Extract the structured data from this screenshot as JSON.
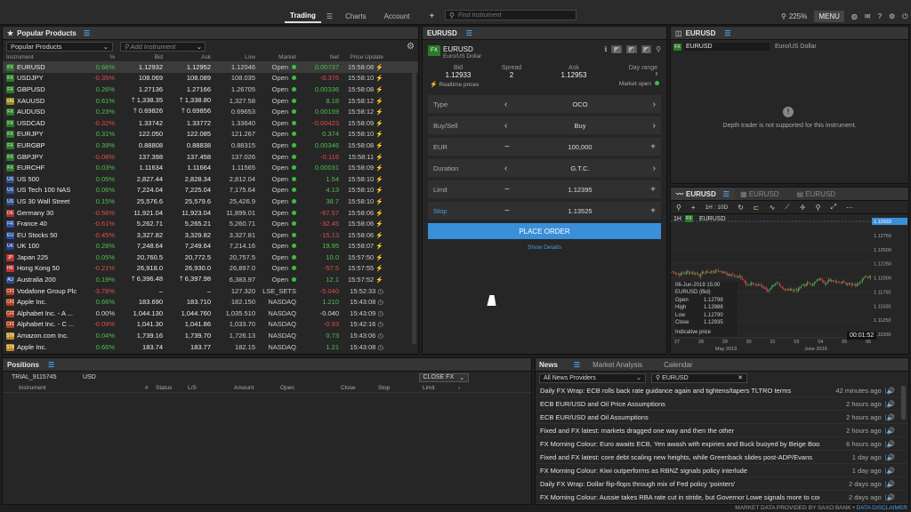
{
  "topbar": {
    "tabs": [
      "Trading",
      "Charts",
      "Account"
    ],
    "add": "+",
    "search_placeholder": "Find Instrument",
    "zoom": "225%",
    "menu": "MENU"
  },
  "watchlist": {
    "title": "Popular Products",
    "list_name": "Popular Products",
    "add_placeholder": "Add Instrument",
    "columns": [
      "Instrument",
      "%",
      "Bid",
      "Ask",
      "Low",
      "Market",
      "Net",
      "Price Update"
    ],
    "rows": [
      {
        "name": "EURUSD",
        "icon": "FX",
        "pct": "0.66%",
        "bid": "1.12932",
        "ask": "1.12952",
        "low": "1.12046",
        "market": "Open",
        "net": "0.00737",
        "time": "15:58:08",
        "dir": "pos",
        "sel": true
      },
      {
        "name": "USDJPY",
        "icon": "FX",
        "pct": "-0.35%",
        "bid": "108.069",
        "ask": "108.089",
        "low": "108.035",
        "market": "Open",
        "net": "-0.376",
        "time": "15:58:10",
        "dir": "neg"
      },
      {
        "name": "GBPUSD",
        "icon": "FX",
        "pct": "0.26%",
        "bid": "1.27136",
        "ask": "1.27166",
        "low": "1.26705",
        "market": "Open",
        "net": "0.00336",
        "time": "15:58:08",
        "dir": "pos"
      },
      {
        "name": "XAUUSD",
        "icon": "XAU",
        "pct": "0.61%",
        "bid": "1,338.35",
        "ask": "1,338.80",
        "low": "1,327.58",
        "market": "Open",
        "net": "8.18",
        "time": "15:58:12",
        "dir": "pos",
        "arrow": true
      },
      {
        "name": "AUDUSD",
        "icon": "FX",
        "pct": "0.23%",
        "bid": "0.69826",
        "ask": "0.69856",
        "low": "0.69653",
        "market": "Open",
        "net": "0.00159",
        "time": "15:58:12",
        "dir": "pos",
        "arrow": true
      },
      {
        "name": "USDCAD",
        "icon": "FX",
        "pct": "-0.32%",
        "bid": "1.33742",
        "ask": "1.33772",
        "low": "1.33640",
        "market": "Open",
        "net": "-0.00423",
        "time": "15:58:09",
        "dir": "neg"
      },
      {
        "name": "EURJPY",
        "icon": "FX",
        "pct": "0.31%",
        "bid": "122.050",
        "ask": "122.085",
        "low": "121.267",
        "market": "Open",
        "net": "0.374",
        "time": "15:58:10",
        "dir": "pos"
      },
      {
        "name": "EURGBP",
        "icon": "FX",
        "pct": "0.39%",
        "bid": "0.88808",
        "ask": "0.88838",
        "low": "0.88315",
        "market": "Open",
        "net": "0.00346",
        "time": "15:58:08",
        "dir": "pos"
      },
      {
        "name": "GBPJPY",
        "icon": "FX",
        "pct": "-0.08%",
        "bid": "137.398",
        "ask": "137.458",
        "low": "137.026",
        "market": "Open",
        "net": "-0.116",
        "time": "15:58:11",
        "dir": "neg"
      },
      {
        "name": "EURCHF",
        "icon": "FX",
        "pct": "0.03%",
        "bid": "1.11634",
        "ask": "1.11664",
        "low": "1.11565",
        "market": "Open",
        "net": "0.00031",
        "time": "15:58:09",
        "dir": "pos"
      },
      {
        "name": "US 500",
        "icon": "US",
        "pct": "0.05%",
        "bid": "2,827.44",
        "ask": "2,828.34",
        "low": "2,812.04",
        "market": "Open",
        "net": "1.54",
        "time": "15:58:10",
        "dir": "pos"
      },
      {
        "name": "US Tech 100 NAS",
        "icon": "US",
        "pct": "0.06%",
        "bid": "7,224.04",
        "ask": "7,225.04",
        "low": "7,175.64",
        "market": "Open",
        "net": "4.13",
        "time": "15:58:10",
        "dir": "pos"
      },
      {
        "name": "US 30 Wall Street",
        "icon": "US",
        "pct": "0.15%",
        "bid": "25,576.6",
        "ask": "25,579.6",
        "low": "25,426.9",
        "market": "Open",
        "net": "38.7",
        "time": "15:58:10",
        "dir": "pos"
      },
      {
        "name": "Germany 30",
        "icon": "DE",
        "pct": "-0.56%",
        "bid": "11,921.04",
        "ask": "11,923.04",
        "low": "11,899.01",
        "market": "Open",
        "net": "-67.57",
        "time": "15:58:06",
        "dir": "neg"
      },
      {
        "name": "France 40",
        "icon": "FR",
        "pct": "-0.61%",
        "bid": "5,262.71",
        "ask": "5,265.21",
        "low": "5,260.71",
        "market": "Open",
        "net": "-32.45",
        "time": "15:58:06",
        "dir": "neg"
      },
      {
        "name": "EU Stocks 50",
        "icon": "EU",
        "pct": "-0.45%",
        "bid": "3,327.82",
        "ask": "3,329.82",
        "low": "3,327.81",
        "market": "Open",
        "net": "-15.13",
        "time": "15:58:06",
        "dir": "neg"
      },
      {
        "name": "UK 100",
        "icon": "UK",
        "pct": "0.28%",
        "bid": "7,248.64",
        "ask": "7,249.64",
        "low": "7,214.16",
        "market": "Open",
        "net": "19.95",
        "time": "15:58:07",
        "dir": "pos"
      },
      {
        "name": "Japan 225",
        "icon": "JP",
        "pct": "0.05%",
        "bid": "20,760.5",
        "ask": "20,772.5",
        "low": "20,757.5",
        "market": "Open",
        "net": "10.0",
        "time": "15:57:50",
        "dir": "pos"
      },
      {
        "name": "Hong Kong 50",
        "icon": "HK",
        "pct": "-0.21%",
        "bid": "26,918.0",
        "ask": "26,930.0",
        "low": "26,897.0",
        "market": "Open",
        "net": "-57.5",
        "time": "15:57:55",
        "dir": "neg"
      },
      {
        "name": "Australia 200",
        "icon": "AU",
        "pct": "0.19%",
        "bid": "6,396.48",
        "ask": "6,397.98",
        "low": "6,383.97",
        "market": "Open",
        "net": "12.1",
        "time": "15:57:52",
        "dir": "pos",
        "arrow": true
      },
      {
        "name": "Vodafone Group Plc",
        "icon": "CFD",
        "pct": "-3.78%",
        "bid": "–",
        "ask": "–",
        "low": "127.320",
        "market": "LSE_SETS",
        "net": "-5.040",
        "time": "15:52:33",
        "dir": "neg",
        "closed": true
      },
      {
        "name": "Apple Inc.",
        "icon": "CFD",
        "pct": "0.66%",
        "bid": "183.690",
        "ask": "183.710",
        "low": "182.150",
        "market": "NASDAQ",
        "net": "1.210",
        "time": "15:43:08",
        "dir": "pos",
        "closed": true
      },
      {
        "name": "Alphabet Inc. - A ...",
        "icon": "CFD",
        "pct": "0.00%",
        "bid": "1,044.130",
        "ask": "1,044.760",
        "low": "1,035.510",
        "market": "NASDAQ",
        "net": "-0.040",
        "time": "15:43:09",
        "dir": "neu",
        "closed": true
      },
      {
        "name": "Alphabet Inc. - C ...",
        "icon": "CFD",
        "pct": "-0.09%",
        "bid": "1,041.30",
        "ask": "1,041.86",
        "low": "1,033.70",
        "market": "NASDAQ",
        "net": "-0.93",
        "time": "15:42:16",
        "dir": "neg",
        "closed": true
      },
      {
        "name": "Amazon.com Inc.",
        "icon": "STK",
        "pct": "0.04%",
        "bid": "1,739.16",
        "ask": "1,739.70",
        "low": "1,726.13",
        "market": "NASDAQ",
        "net": "0.73",
        "time": "15:43:06",
        "dir": "pos",
        "closed": true
      },
      {
        "name": "Apple Inc.",
        "icon": "STK",
        "pct": "0.66%",
        "bid": "183.74",
        "ask": "183.77",
        "low": "182.15",
        "market": "NASDAQ",
        "net": "1.21",
        "time": "15:43:08",
        "dir": "pos",
        "closed": true
      }
    ]
  },
  "ticket": {
    "title": "EURUSD",
    "symbol": "EURUSD",
    "desc": "Euro/US Dollar",
    "bid_label": "Bid",
    "bid": "1.12933",
    "spread_label": "Spread",
    "spread": "2",
    "ask_label": "Ask",
    "ask": "1.12953",
    "range_label": "Day range",
    "realtime": "Realtime prices",
    "market_open": "Market open",
    "fields": [
      {
        "label": "Type",
        "value": "OCO",
        "kind": "arrow"
      },
      {
        "label": "Buy/Sell",
        "value": "Buy",
        "kind": "arrow"
      },
      {
        "label": "EUR",
        "value": "100,000",
        "kind": "step"
      },
      {
        "label": "Duration",
        "value": "G.T.C.",
        "kind": "arrow"
      },
      {
        "label": "Limit",
        "value": "1.12395",
        "kind": "step"
      },
      {
        "label": "Stop",
        "value": "1.13525",
        "kind": "step",
        "active": true
      }
    ],
    "place": "PLACE ORDER",
    "details": "Show Details"
  },
  "depth": {
    "title": "EURUSD",
    "symbol": "EURUSD",
    "desc": "Euro/US Dollar",
    "msg": "Depth trader is not supported for this instrument."
  },
  "chart": {
    "tabs": [
      "EURUSD",
      "EURUSD",
      "EURUSD"
    ],
    "interval": "1H : 10D",
    "tf": "1H",
    "symbol": "EURUSD",
    "price_tag": "1.12933",
    "info": {
      "date": "06-Jun-2019 15:00",
      "name": "EURUSD (Bid)",
      "open_l": "Open",
      "open": "1.12798",
      "high_l": "High",
      "high": "1.12988",
      "low_l": "Low",
      "low": "1.12790",
      "close_l": "Close",
      "close": "1.12935",
      "note": "Indicative price"
    },
    "timer": "00:01:52",
    "months": [
      "May 2019",
      "June 2019"
    ],
    "days": [
      "27",
      "28",
      "29",
      "30",
      "31",
      "03",
      "04",
      "05",
      "06"
    ],
    "yticks": [
      "1.12933",
      "1.12750",
      "1.12500",
      "1.12250",
      "1.12000",
      "1.11750",
      "1.11500",
      "1.11250",
      "1.11000"
    ]
  },
  "positions": {
    "title": "Positions",
    "account": "TRIAL_9115745",
    "currency": "USD",
    "close_fx": "CLOSE FX",
    "columns": [
      "Instrument",
      "#",
      "Status",
      "L/S",
      "Amount",
      "Open",
      "Close",
      "Stop",
      "Limit"
    ]
  },
  "news": {
    "tabs": [
      "News",
      "Market Analysis",
      "Calendar"
    ],
    "provider": "All News Providers",
    "search": "EURUSD",
    "items": [
      {
        "t": "Daily FX Wrap: ECB rolls back rate guidance again and tightens/tapers TLTRO terms",
        "a": "42 minutes ago"
      },
      {
        "t": "ECB EUR/USD and Oil Price Assumptions",
        "a": "2 hours ago"
      },
      {
        "t": "ECB EUR/USD and Oil Assumptions",
        "a": "2 hours ago"
      },
      {
        "t": "Fixed and FX latest: markets dragged one way and then the other",
        "a": "2 hours ago"
      },
      {
        "t": "FX Morning Colour: Euro awaits ECB, Yen awash with expiries and Buck buoyed by Beige Book",
        "a": "6 hours ago"
      },
      {
        "t": "Fixed and FX latest: core debt scaling new heights, while Greenback slides post-ADP/Evans",
        "a": "1 day ago"
      },
      {
        "t": "FX Morning Colour: Kiwi outperforms as RBNZ signals policy interlude",
        "a": "1 day ago"
      },
      {
        "t": "Daily FX Wrap: Dollar flip-flops through mix of Fed policy 'pointers'",
        "a": "2 days ago"
      },
      {
        "t": "FX Morning Colour: Aussie takes RBA rate cut in stride, but Governor Lowe signals more to come",
        "a": "2 days ago"
      }
    ]
  },
  "footer": {
    "provided": "MARKET DATA PROVIDED BY SAXO BANK",
    "sep": " • ",
    "disclaimer": "DATA DISCLAIMER"
  },
  "colors": {
    "accent": "#3a8fd9",
    "pos": "#4cc24c",
    "neg": "#e34b4b",
    "bg": "#1f1f1f"
  }
}
